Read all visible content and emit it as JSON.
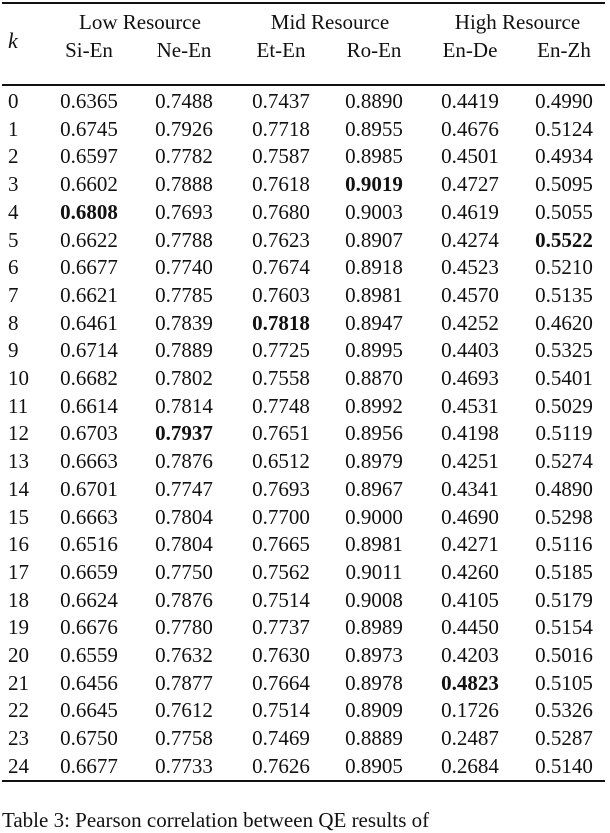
{
  "table": {
    "k_label": "k",
    "groups": [
      "Low Resource",
      "Mid Resource",
      "High Resource"
    ],
    "columns": [
      "Si-En",
      "Ne-En",
      "Et-En",
      "Ro-En",
      "En-De",
      "En-Zh"
    ],
    "rows": [
      {
        "k": "0",
        "values": [
          "0.6365",
          "0.7488",
          "0.7437",
          "0.8890",
          "0.4419",
          "0.4990"
        ],
        "bold": []
      },
      {
        "k": "1",
        "values": [
          "0.6745",
          "0.7926",
          "0.7718",
          "0.8955",
          "0.4676",
          "0.5124"
        ],
        "bold": []
      },
      {
        "k": "2",
        "values": [
          "0.6597",
          "0.7782",
          "0.7587",
          "0.8985",
          "0.4501",
          "0.4934"
        ],
        "bold": []
      },
      {
        "k": "3",
        "values": [
          "0.6602",
          "0.7888",
          "0.7618",
          "0.9019",
          "0.4727",
          "0.5095"
        ],
        "bold": [
          3
        ]
      },
      {
        "k": "4",
        "values": [
          "0.6808",
          "0.7693",
          "0.7680",
          "0.9003",
          "0.4619",
          "0.5055"
        ],
        "bold": [
          0
        ]
      },
      {
        "k": "5",
        "values": [
          "0.6622",
          "0.7788",
          "0.7623",
          "0.8907",
          "0.4274",
          "0.5522"
        ],
        "bold": [
          5
        ]
      },
      {
        "k": "6",
        "values": [
          "0.6677",
          "0.7740",
          "0.7674",
          "0.8918",
          "0.4523",
          "0.5210"
        ],
        "bold": []
      },
      {
        "k": "7",
        "values": [
          "0.6621",
          "0.7785",
          "0.7603",
          "0.8981",
          "0.4570",
          "0.5135"
        ],
        "bold": []
      },
      {
        "k": "8",
        "values": [
          "0.6461",
          "0.7839",
          "0.7818",
          "0.8947",
          "0.4252",
          "0.4620"
        ],
        "bold": [
          2
        ]
      },
      {
        "k": "9",
        "values": [
          "0.6714",
          "0.7889",
          "0.7725",
          "0.8995",
          "0.4403",
          "0.5325"
        ],
        "bold": []
      },
      {
        "k": "10",
        "values": [
          "0.6682",
          "0.7802",
          "0.7558",
          "0.8870",
          "0.4693",
          "0.5401"
        ],
        "bold": []
      },
      {
        "k": "11",
        "values": [
          "0.6614",
          "0.7814",
          "0.7748",
          "0.8992",
          "0.4531",
          "0.5029"
        ],
        "bold": []
      },
      {
        "k": "12",
        "values": [
          "0.6703",
          "0.7937",
          "0.7651",
          "0.8956",
          "0.4198",
          "0.5119"
        ],
        "bold": [
          1
        ]
      },
      {
        "k": "13",
        "values": [
          "0.6663",
          "0.7876",
          "0.6512",
          "0.8979",
          "0.4251",
          "0.5274"
        ],
        "bold": []
      },
      {
        "k": "14",
        "values": [
          "0.6701",
          "0.7747",
          "0.7693",
          "0.8967",
          "0.4341",
          "0.4890"
        ],
        "bold": []
      },
      {
        "k": "15",
        "values": [
          "0.6663",
          "0.7804",
          "0.7700",
          "0.9000",
          "0.4690",
          "0.5298"
        ],
        "bold": []
      },
      {
        "k": "16",
        "values": [
          "0.6516",
          "0.7804",
          "0.7665",
          "0.8981",
          "0.4271",
          "0.5116"
        ],
        "bold": []
      },
      {
        "k": "17",
        "values": [
          "0.6659",
          "0.7750",
          "0.7562",
          "0.9011",
          "0.4260",
          "0.5185"
        ],
        "bold": []
      },
      {
        "k": "18",
        "values": [
          "0.6624",
          "0.7876",
          "0.7514",
          "0.9008",
          "0.4105",
          "0.5179"
        ],
        "bold": []
      },
      {
        "k": "19",
        "values": [
          "0.6676",
          "0.7780",
          "0.7737",
          "0.8989",
          "0.4450",
          "0.5154"
        ],
        "bold": []
      },
      {
        "k": "20",
        "values": [
          "0.6559",
          "0.7632",
          "0.7630",
          "0.8973",
          "0.4203",
          "0.5016"
        ],
        "bold": []
      },
      {
        "k": "21",
        "values": [
          "0.6456",
          "0.7877",
          "0.7664",
          "0.8978",
          "0.4823",
          "0.5105"
        ],
        "bold": [
          4
        ]
      },
      {
        "k": "22",
        "values": [
          "0.6645",
          "0.7612",
          "0.7514",
          "0.8909",
          "0.1726",
          "0.5326"
        ],
        "bold": []
      },
      {
        "k": "23",
        "values": [
          "0.6750",
          "0.7758",
          "0.7469",
          "0.8889",
          "0.2487",
          "0.5287"
        ],
        "bold": []
      },
      {
        "k": "24",
        "values": [
          "0.6677",
          "0.7733",
          "0.7626",
          "0.8905",
          "0.2684",
          "0.5140"
        ],
        "bold": []
      }
    ]
  },
  "caption": "Table 3: Pearson correlation between QE results of"
}
